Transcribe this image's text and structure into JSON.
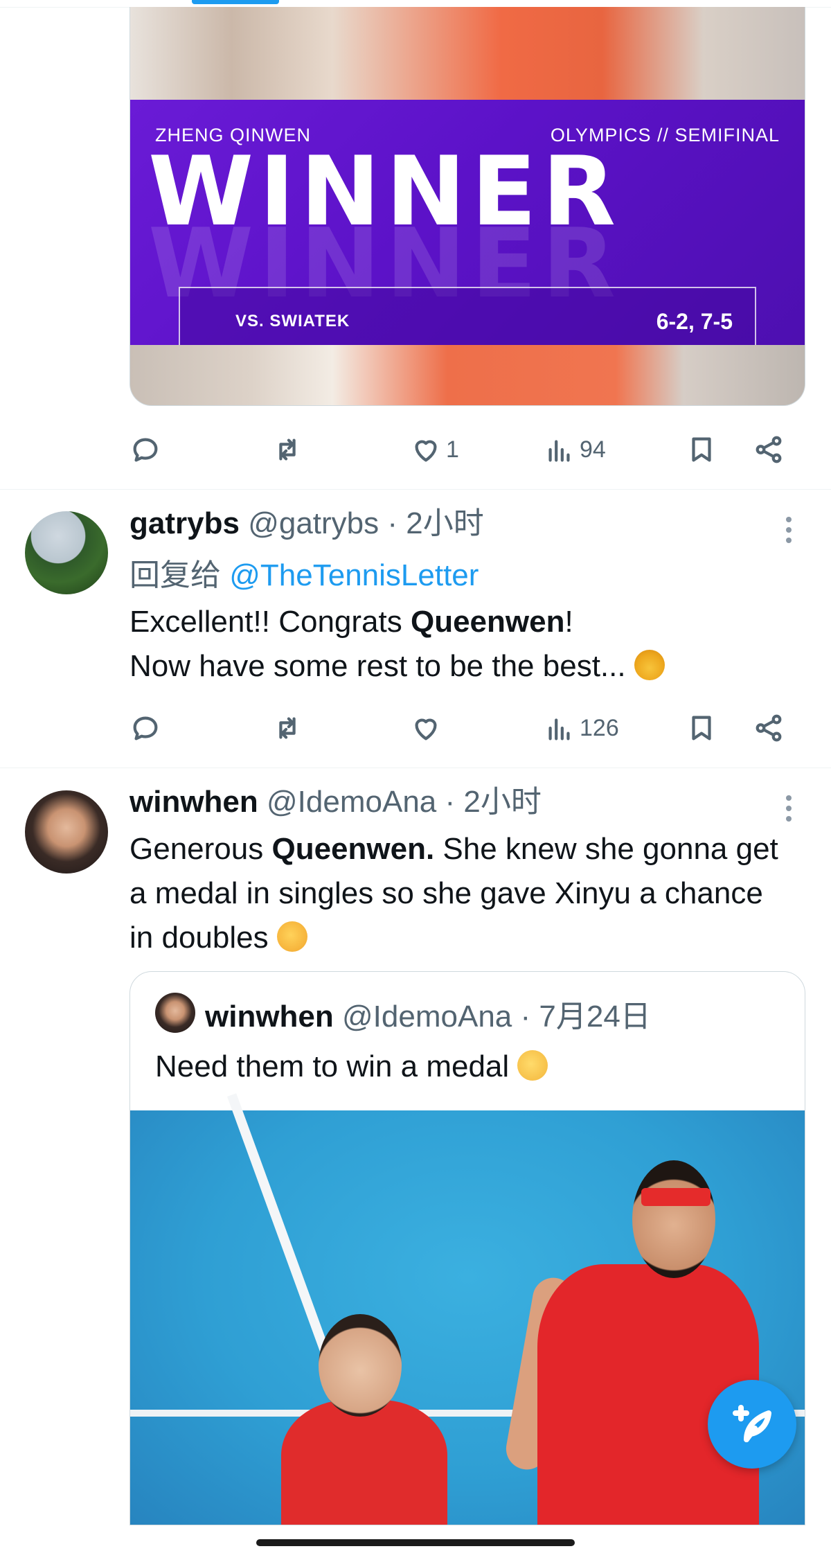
{
  "media_card": {
    "player": "ZHENG QINWEN",
    "event": "OLYMPICS // SEMIFINAL",
    "headline": "WINNER",
    "opponent": "VS. SWIATEK",
    "score": "6-2, 7-5"
  },
  "tweet0_actions": {
    "likes": "1",
    "views": "94"
  },
  "tweet1": {
    "name": "gatrybs",
    "handle": "@gatrybs",
    "sep": " · ",
    "time": "2小时",
    "reply_prefix": "回复给 ",
    "reply_handle": "@TheTennisLetter",
    "text_1": "Excellent!! Congrats ",
    "text_bold": "Queenwen",
    "text_2": "!",
    "text_line2": "Now have some rest to be the best... ",
    "views": "126"
  },
  "tweet2": {
    "name": "winwhen",
    "handle": "@IdemoAna",
    "sep": " · ",
    "time": "2小时",
    "text_1": "Generous ",
    "text_bold": "Queenwen.",
    "text_2": " She knew she gonna get a medal in singles so she gave Xinyu a chance in doubles "
  },
  "quote": {
    "name": "winwhen",
    "handle": "@IdemoAna",
    "sep": " · ",
    "date": "7月24日",
    "text": "Need them to win a medal "
  },
  "colors": {
    "accent": "#1d9bf0",
    "panel": "#5c12c8",
    "muted": "#536471"
  },
  "icons": [
    "reply-icon",
    "retweet-icon",
    "like-icon",
    "views-icon",
    "bookmark-icon",
    "share-icon",
    "more-icon",
    "compose-icon"
  ]
}
